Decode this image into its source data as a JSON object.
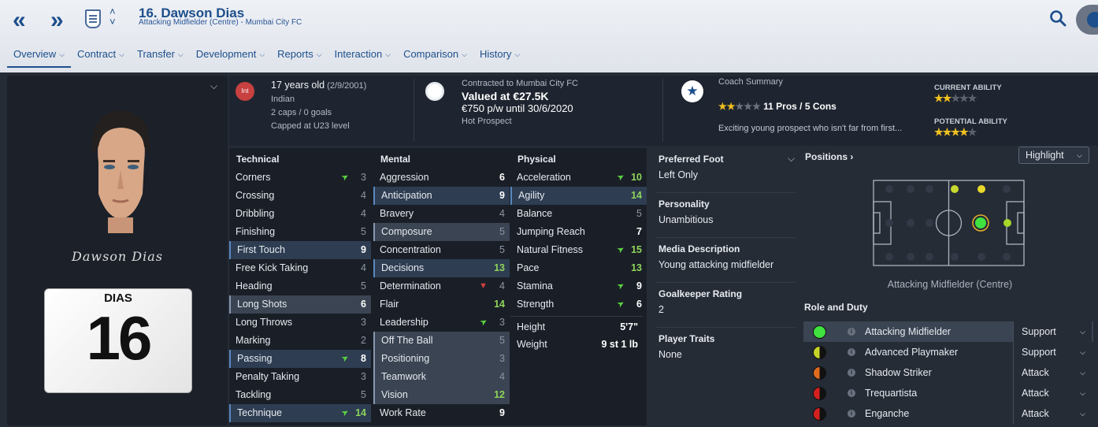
{
  "header": {
    "back_icon": "double-chevron-left-icon",
    "forward_icon": "double-chevron-right-icon",
    "player_title": "16. Dawson Dias",
    "player_subtitle": "Attacking Midfielder (Centre) - Mumbai City FC"
  },
  "menu": [
    {
      "label": "Overview"
    },
    {
      "label": "Contract"
    },
    {
      "label": "Transfer"
    },
    {
      "label": "Development"
    },
    {
      "label": "Reports"
    },
    {
      "label": "Interaction"
    },
    {
      "label": "Comparison"
    },
    {
      "label": "History"
    }
  ],
  "profile": {
    "signature": "Dawson Dias",
    "shirt_name": "DIAS",
    "shirt_number": "16"
  },
  "info": {
    "badge_label": "Int",
    "age": "17 years old",
    "dob": "(2/9/2001)",
    "nationality": "Indian",
    "caps": "2 caps / 0 goals",
    "capped": "Capped at U23 level",
    "contract_label": "Contracted to Mumbai City FC",
    "valued": "Valued at €27.5K",
    "wage": "€750 p/w until 30/6/2020",
    "status": "Hot Prospect",
    "coach_summary_label": "Coach Summary",
    "coach_stars": 2,
    "pros_cons": "11 Pros / 5 Cons",
    "coach_desc": "Exciting young prospect who isn't far from first...",
    "current_ability_label": "CURRENT ABILITY",
    "current_ability_stars": 1.5,
    "potential_ability_label": "POTENTIAL ABILITY",
    "potential_ability_stars": 4
  },
  "attributes": {
    "technical_label": "Technical",
    "mental_label": "Mental",
    "physical_label": "Physical",
    "technical": [
      {
        "name": "Corners",
        "value": "3",
        "arrow": "up"
      },
      {
        "name": "Crossing",
        "value": "4"
      },
      {
        "name": "Dribbling",
        "value": "4"
      },
      {
        "name": "Finishing",
        "value": "5"
      },
      {
        "name": "First Touch",
        "value": "9",
        "hl": "hl"
      },
      {
        "name": "Free Kick Taking",
        "value": "4"
      },
      {
        "name": "Heading",
        "value": "5"
      },
      {
        "name": "Long Shots",
        "value": "6",
        "hl": "gh"
      },
      {
        "name": "Long Throws",
        "value": "3"
      },
      {
        "name": "Marking",
        "value": "2"
      },
      {
        "name": "Passing",
        "value": "8",
        "hl": "hl",
        "arrow": "up"
      },
      {
        "name": "Penalty Taking",
        "value": "3"
      },
      {
        "name": "Tackling",
        "value": "5"
      },
      {
        "name": "Technique",
        "value": "14",
        "hl": "hl",
        "arrow": "up"
      }
    ],
    "mental": [
      {
        "name": "Aggression",
        "value": "6"
      },
      {
        "name": "Anticipation",
        "value": "9",
        "hl": "hl"
      },
      {
        "name": "Bravery",
        "value": "4"
      },
      {
        "name": "Composure",
        "value": "5",
        "hl": "gh"
      },
      {
        "name": "Concentration",
        "value": "5"
      },
      {
        "name": "Decisions",
        "value": "13",
        "hl": "hl"
      },
      {
        "name": "Determination",
        "value": "4",
        "arrow": "down"
      },
      {
        "name": "Flair",
        "value": "14"
      },
      {
        "name": "Leadership",
        "value": "3",
        "arrow": "up"
      },
      {
        "name": "Off The Ball",
        "value": "5",
        "hl": "gh"
      },
      {
        "name": "Positioning",
        "value": "3",
        "hl": "gh"
      },
      {
        "name": "Teamwork",
        "value": "4",
        "hl": "gh"
      },
      {
        "name": "Vision",
        "value": "12",
        "hl": "gh"
      },
      {
        "name": "Work Rate",
        "value": "9"
      }
    ],
    "physical": [
      {
        "name": "Acceleration",
        "value": "10",
        "arrow": "up"
      },
      {
        "name": "Agility",
        "value": "14",
        "hl": "hl"
      },
      {
        "name": "Balance",
        "value": "5"
      },
      {
        "name": "Jumping Reach",
        "value": "7"
      },
      {
        "name": "Natural Fitness",
        "value": "15",
        "arrow": "up"
      },
      {
        "name": "Pace",
        "value": "13"
      },
      {
        "name": "Stamina",
        "value": "9",
        "arrow": "up"
      },
      {
        "name": "Strength",
        "value": "6",
        "arrow": "up"
      }
    ],
    "height_label": "Height",
    "height": "5'7\"",
    "weight_label": "Weight",
    "weight": "9 st 1 lb"
  },
  "details": {
    "preferred_foot_label": "Preferred Foot",
    "preferred_foot": "Left Only",
    "personality_label": "Personality",
    "personality": "Unambitious",
    "media_label": "Media Description",
    "media": "Young attacking midfielder",
    "gk_label": "Goalkeeper Rating",
    "gk": "2",
    "traits_label": "Player Traits",
    "traits": "None"
  },
  "positions": {
    "label": "Positions",
    "highlight_label": "Highlight",
    "caption": "Attacking Midfielder (Centre)",
    "role_duty_label": "Role and Duty",
    "roles": [
      {
        "name": "Attacking Midfielder",
        "duty": "Support",
        "color": "#3fe23f",
        "selected": true
      },
      {
        "name": "Advanced Playmaker",
        "duty": "Support",
        "color": "#c6d42a"
      },
      {
        "name": "Shadow Striker",
        "duty": "Attack",
        "color": "#e06a1f"
      },
      {
        "name": "Trequartista",
        "duty": "Attack",
        "color": "#d62020"
      },
      {
        "name": "Enganche",
        "duty": "Attack",
        "color": "#d62020"
      }
    ]
  },
  "colors": {
    "accent": "#1d4f8c",
    "positive": "#8ed45a",
    "star": "#f0c020",
    "background": "#262c36"
  }
}
